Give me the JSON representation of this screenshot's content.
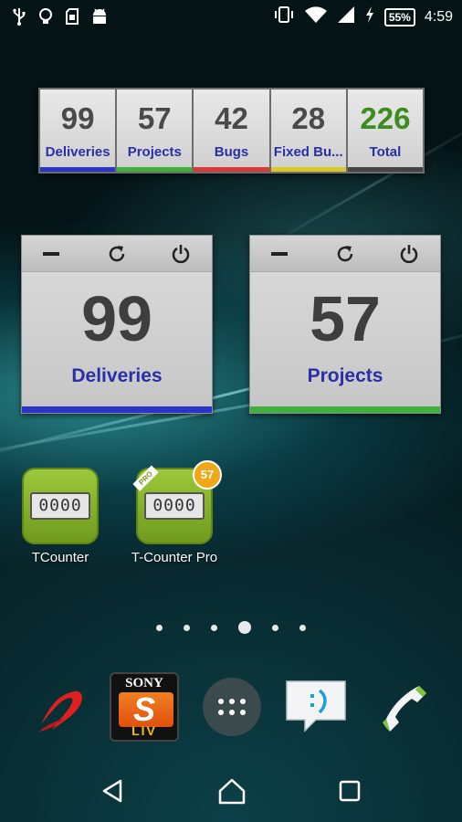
{
  "status_bar": {
    "left_icons": [
      "usb-icon",
      "lightbulb-icon",
      "sd-card-icon",
      "android-icon"
    ],
    "right_icons": [
      "vibrate-icon",
      "wifi-icon",
      "signal-icon",
      "charging-icon"
    ],
    "battery": "55%",
    "time": "4:59"
  },
  "summary_widget": {
    "cells": [
      {
        "value": "99",
        "label": "Deliveries",
        "color": "#2a34c8"
      },
      {
        "value": "57",
        "label": "Projects",
        "color": "#3fb03a"
      },
      {
        "value": "42",
        "label": "Bugs",
        "color": "#d83a3a"
      },
      {
        "value": "28",
        "label": "Fixed Bu...",
        "color": "#d8c82a"
      },
      {
        "value": "226",
        "label": "Total",
        "color": "#444444",
        "value_color": "#3c8c1e"
      }
    ]
  },
  "counter_widgets": [
    {
      "value": "99",
      "label": "Deliveries",
      "bar_color": "#2a34c8"
    },
    {
      "value": "57",
      "label": "Projects",
      "bar_color": "#3fb03a"
    }
  ],
  "apps": [
    {
      "name": "TCounter",
      "display": "0000"
    },
    {
      "name": "T-Counter Pro",
      "display": "0000",
      "badge": "57",
      "ribbon": "PRO"
    }
  ],
  "page_indicator": {
    "count": 6,
    "active": 3
  },
  "dock": {
    "items": [
      "music-app-icon",
      "sony-liv-icon",
      "app-drawer-icon",
      "messaging-icon",
      "phone-icon"
    ],
    "sony_liv": {
      "brand": "SONY",
      "letter": "S",
      "sub": "LIV"
    }
  },
  "nav_bar": [
    "back-icon",
    "home-icon",
    "recents-icon"
  ]
}
